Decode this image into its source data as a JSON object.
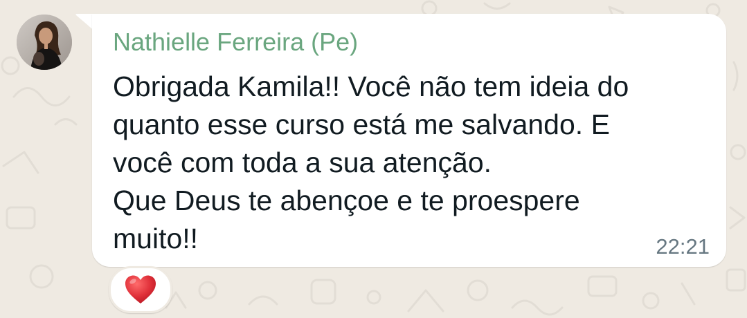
{
  "chat": {
    "message": {
      "sender": "Nathielle Ferreira (Pe)",
      "lines": [
        "Obrigada Kamila!! Você não tem ideia do",
        "quanto esse curso está me salvando. E",
        "você com toda a sua atenção.",
        "Que Deus te abençoe e te proespere",
        "muito!!"
      ],
      "time": "22:21",
      "reaction_icon": "red-heart-icon"
    },
    "avatar_icon": "profile-photo"
  },
  "colors": {
    "background": "#efeae2",
    "bubble": "#ffffff",
    "sender_name": "#6aa67f",
    "message_text": "#111b21",
    "timestamp": "#667781",
    "heart": "#e0313a"
  }
}
